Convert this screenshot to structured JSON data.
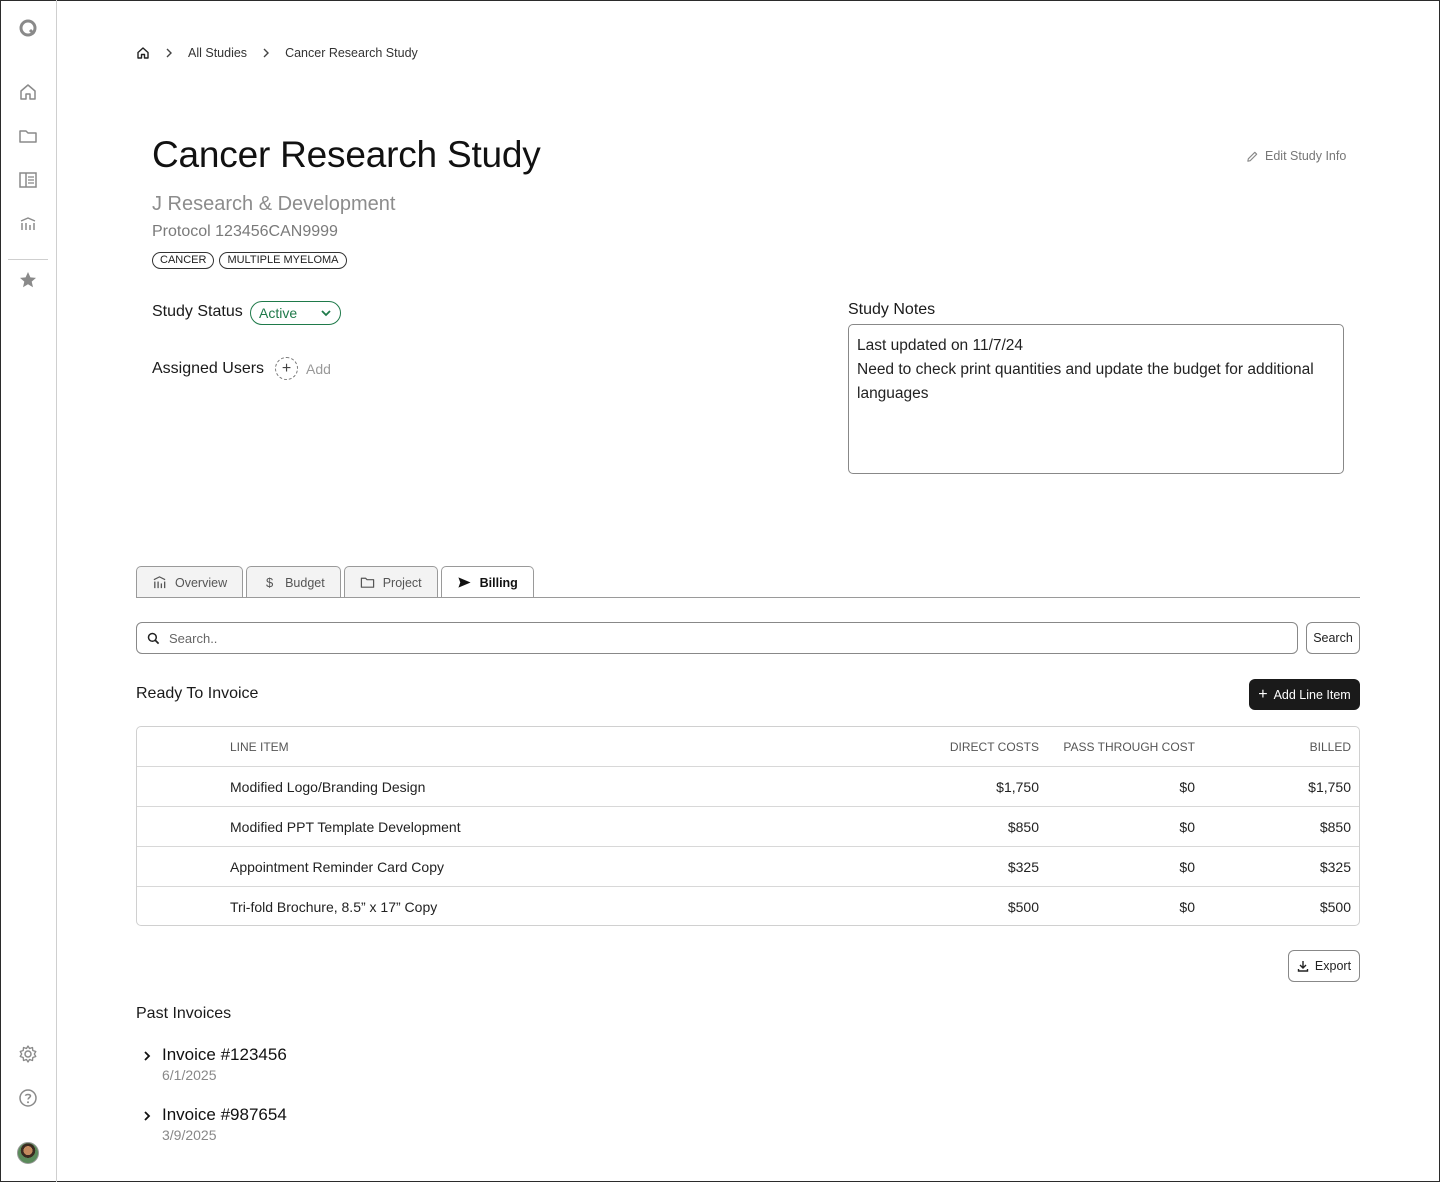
{
  "breadcrumb": {
    "items": [
      "All Studies",
      "Cancer Research Study"
    ]
  },
  "study": {
    "title": "Cancer Research Study",
    "edit_label": "Edit Study Info",
    "subtitle": "J Research & Development",
    "protocol": "Protocol 123456CAN9999",
    "tags": [
      "CANCER",
      "MULTIPLE MYELOMA"
    ],
    "status_label": "Study Status",
    "status_value": "Active",
    "users_label": "Assigned Users",
    "add_label": "Add",
    "notes_label": "Study Notes",
    "notes_lines": [
      "Last updated on 11/7/24",
      "Need to check print quantities and update the budget for additional languages"
    ]
  },
  "tabs": [
    {
      "label": "Overview",
      "icon": "chart-icon"
    },
    {
      "label": "Budget",
      "icon": "dollar-icon"
    },
    {
      "label": "Project",
      "icon": "folder-icon"
    },
    {
      "label": "Billing",
      "icon": "send-icon",
      "active": true
    }
  ],
  "search": {
    "placeholder": "Search..",
    "button_label": "Search"
  },
  "ready_to_invoice": {
    "title": "Ready To Invoice",
    "add_button_label": "Add Line Item",
    "columns": [
      "LINE ITEM",
      "DIRECT COSTS",
      "PASS THROUGH COST",
      "BILLED"
    ],
    "rows": [
      {
        "item": "Modified Logo/Branding Design",
        "direct": "$1,750",
        "pass": "$0",
        "billed": "$1,750"
      },
      {
        "item": "Modified PPT Template Development",
        "direct": "$850",
        "pass": "$0",
        "billed": "$850"
      },
      {
        "item": "Appointment Reminder Card Copy",
        "direct": "$325",
        "pass": "$0",
        "billed": "$325"
      },
      {
        "item": "Tri-fold Brochure, 8.5” x 17” Copy",
        "direct": "$500",
        "pass": "$0",
        "billed": "$500"
      }
    ],
    "export_label": "Export"
  },
  "past_invoices": {
    "title": "Past Invoices",
    "items": [
      {
        "number": "Invoice #123456",
        "date": "6/1/2025"
      },
      {
        "number": "Invoice #987654",
        "date": "3/9/2025"
      }
    ]
  },
  "colors": {
    "status_green": "#1f7a4a",
    "primary_button": "#1a1a1a"
  }
}
